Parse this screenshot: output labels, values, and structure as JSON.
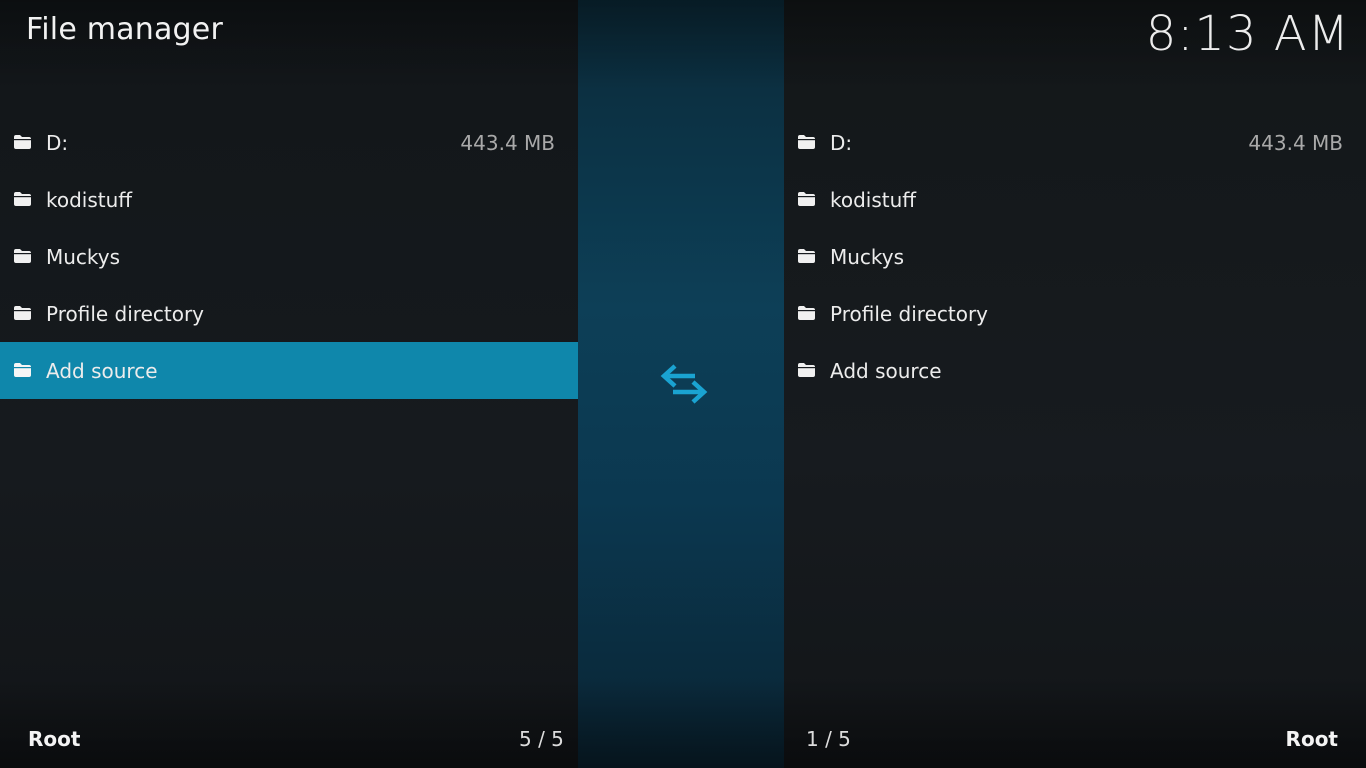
{
  "header": {
    "title": "File manager",
    "clock": "8:13 AM"
  },
  "left_pane": {
    "items": [
      {
        "label": "D:",
        "size": "443.4 MB",
        "icon": "folder-icon"
      },
      {
        "label": "kodistuff",
        "size": "",
        "icon": "folder-icon"
      },
      {
        "label": "Muckys",
        "size": "",
        "icon": "folder-icon"
      },
      {
        "label": "Profile directory",
        "size": "",
        "icon": "folder-icon"
      },
      {
        "label": "Add source",
        "size": "",
        "icon": "folder-icon",
        "selected": true
      }
    ],
    "path": "Root",
    "count": "5 / 5"
  },
  "right_pane": {
    "items": [
      {
        "label": "D:",
        "size": "443.4 MB",
        "icon": "folder-icon"
      },
      {
        "label": "kodistuff",
        "size": "",
        "icon": "folder-icon"
      },
      {
        "label": "Muckys",
        "size": "",
        "icon": "folder-icon"
      },
      {
        "label": "Profile directory",
        "size": "",
        "icon": "folder-icon"
      },
      {
        "label": "Add source",
        "size": "",
        "icon": "folder-icon"
      }
    ],
    "path": "Root",
    "count": "1 / 5"
  },
  "center": {
    "icon": "swap-arrows-icon"
  },
  "colors": {
    "accent": "#0f87ab",
    "swap_icon": "#1aa3d1",
    "background": "#15191d",
    "center_strip": "#0d3f57"
  }
}
